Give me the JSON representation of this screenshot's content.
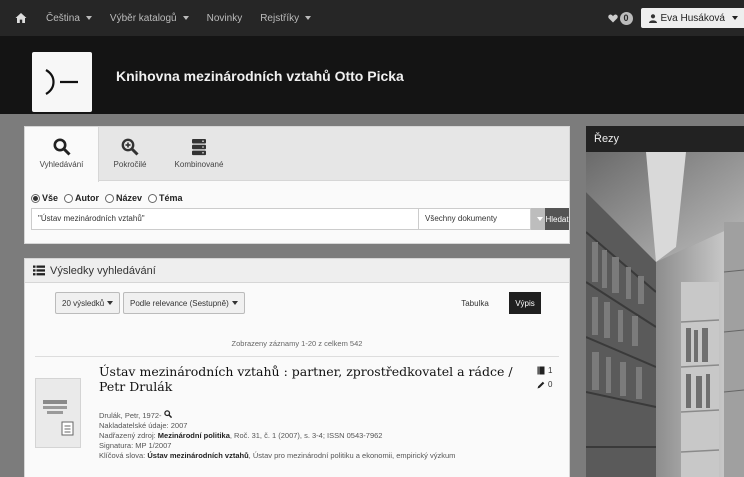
{
  "topnav": {
    "items": [
      {
        "label": "Čeština",
        "dropdown": true
      },
      {
        "label": "Výběr katalogů",
        "dropdown": true
      },
      {
        "label": "Novinky",
        "dropdown": false
      },
      {
        "label": "Rejstříky",
        "dropdown": true
      }
    ],
    "favorites_count": "0",
    "user_name": "Eva Husáková"
  },
  "header": {
    "logo_text": ")—",
    "title": "Knihovna mezinárodních vztahů Otto Picka"
  },
  "search": {
    "tabs": [
      {
        "label": "Vyhledávání",
        "icon": "search-icon",
        "active": true
      },
      {
        "label": "Pokročilé",
        "icon": "zoom-in-icon",
        "active": false
      },
      {
        "label": "Kombinované",
        "icon": "server-icon",
        "active": false
      }
    ],
    "radios": [
      {
        "label": "Vše",
        "checked": true
      },
      {
        "label": "Autor",
        "checked": false
      },
      {
        "label": "Název",
        "checked": false
      },
      {
        "label": "Téma",
        "checked": false
      }
    ],
    "query_value": "\"Ústav mezinárodních vztahů\"",
    "doc_type": "Všechny dokumenty",
    "search_button": "Hledat"
  },
  "results": {
    "heading": "Výsledky vyhledávání",
    "per_page": "20 výsledků",
    "sort": "Podle relevance (Sestupně)",
    "view_table": "Tabulka",
    "view_list": "Výpis",
    "count_text": "Zobrazeny záznamy 1-20 z celkem 542",
    "record": {
      "title": "Ústav mezinárodních vztahů : partner, zprostředkovatel a rádce / Petr Drulák",
      "author": "Drulák, Petr, 1972-",
      "publisher_label": "Nakladatelské údaje:",
      "publisher_value": "2007",
      "source_label": "Nadřazený zdroj:",
      "source_link": "Mezinárodní politika",
      "source_rest": ", Roč. 31, č. 1 (2007), s. 3-4; ISSN 0543-7962",
      "signature_label": "Signatura:",
      "signature_value": "MP 1/2007",
      "keywords_label": "Klíčová slova:",
      "keyword_main": "Ústav mezinárodních vztahů",
      "keywords_rest": ", Ústav pro mezinárodní politiku a ekonomii, empirický výzkum",
      "holdings_count": "1",
      "comments_count": "0"
    }
  },
  "side_panel": {
    "title": "Řezy"
  },
  "colors": {
    "topnav_bg": "#262626",
    "header_bg": "#141414",
    "page_bg": "#7c7c7c",
    "primary_button": "#222222"
  }
}
